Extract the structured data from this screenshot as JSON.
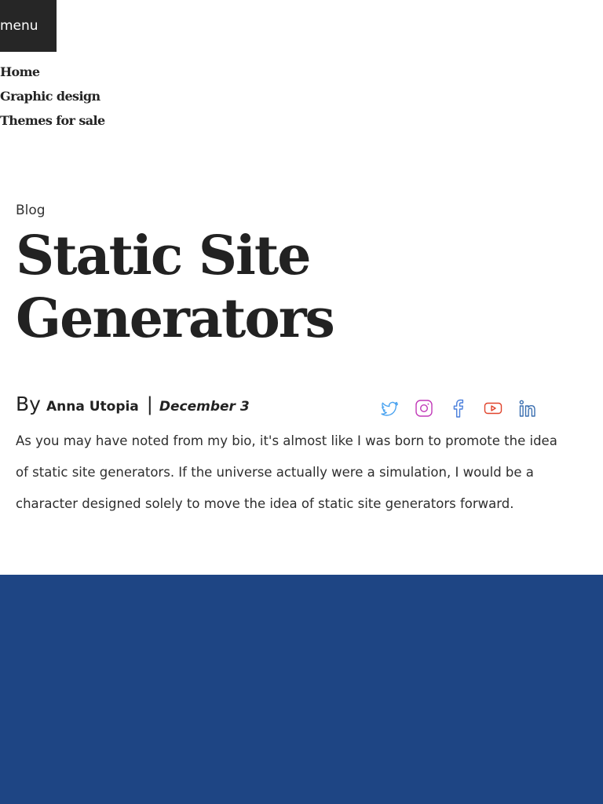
{
  "menu": {
    "label": "menu"
  },
  "nav": {
    "items": [
      {
        "label": "Home"
      },
      {
        "label": "Graphic design"
      },
      {
        "label": "Themes for sale"
      }
    ]
  },
  "post": {
    "category": "Blog",
    "title": "Static Site Generators",
    "by": "By",
    "author": "Anna Utopia",
    "separator": "|",
    "date": "December 3",
    "body": "As you may have noted from my bio, it's almost like I was born to promote the idea of static site generators. If the universe actually were a simulation, I would be a character designed solely to move the idea of static site generators forward."
  },
  "social": [
    {
      "icon": "twitter-icon",
      "color": "#4aa3f0"
    },
    {
      "icon": "instagram-icon",
      "color": "#c13ab8"
    },
    {
      "icon": "facebook-icon",
      "color": "#4a7fdc"
    },
    {
      "icon": "youtube-icon",
      "color": "#e0432b"
    },
    {
      "icon": "linkedin-icon",
      "color": "#3b6fb0"
    }
  ],
  "colors": {
    "band": "#1e4584",
    "menu_bg": "#262626",
    "text": "#242424"
  }
}
